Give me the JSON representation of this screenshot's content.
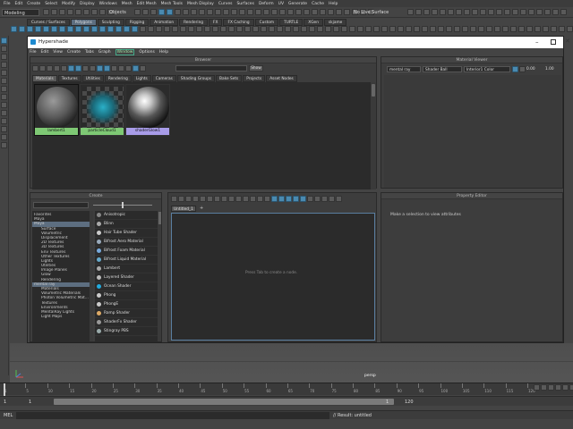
{
  "maya": {
    "menubar": [
      "File",
      "Edit",
      "Create",
      "Select",
      "Modify",
      "Display",
      "Windows",
      "Mesh",
      "Edit Mesh",
      "Mesh Tools",
      "Mesh Display",
      "Curves",
      "Surfaces",
      "Deform",
      "UV",
      "Generate",
      "Cache",
      "Help"
    ],
    "menuset": "Modeling",
    "objects_label": "Objects",
    "live_surface": "No Live Surface",
    "shelf_tabs": [
      "Curves / Surfaces",
      "Polygons",
      "Sculpting",
      "Rigging",
      "Animation",
      "Rendering",
      "FX",
      "FX Caching",
      "Custom",
      "TURTLE",
      "XGen",
      "skjame"
    ],
    "active_shelf": "Polygons",
    "viewport_label": "persp",
    "timeline_ticks": [
      "1",
      "5",
      "10",
      "15",
      "20",
      "25",
      "30",
      "35",
      "40",
      "45",
      "50",
      "55",
      "60",
      "65",
      "70",
      "75",
      "80",
      "85",
      "90",
      "95",
      "100",
      "105",
      "110",
      "115",
      "120"
    ],
    "range_start": "1",
    "range_start2": "1",
    "range_end_field": "1",
    "range_end": "120",
    "cmd_label": "MEL",
    "result_text": "// Result: untitled"
  },
  "hypershade": {
    "title": "Hypershade",
    "menubar": [
      "File",
      "Edit",
      "View",
      "Create",
      "Tabs",
      "Graph",
      "Window",
      "Options",
      "Help"
    ],
    "browser": {
      "title": "Browser",
      "show_label": "Show",
      "tabs": [
        "Materials",
        "Textures",
        "Utilities",
        "Rendering",
        "Lights",
        "Cameras",
        "Shading Groups",
        "Bake Sets",
        "Projects",
        "Asset Nodes"
      ],
      "active_tab": "Materials",
      "swatches": [
        {
          "label": "lambert1",
          "label_color": "#7ec874"
        },
        {
          "label": "particleCloud1",
          "label_color": "#7ec874"
        },
        {
          "label": "shaderGlow1",
          "label_color": "#a89ce8"
        }
      ]
    },
    "material_viewer": {
      "title": "Material Viewer",
      "renderer": "mental ray",
      "shape": "Shader Ball",
      "environment": "Interior1 Color",
      "value1": "0.00",
      "value2": "1.00"
    },
    "create": {
      "title": "Create",
      "categories": [
        "Favorites",
        "Maya",
        "Maya",
        "Surface",
        "Volumetric",
        "Displacement",
        "2D Textures",
        "3D Textures",
        "Env Textures",
        "Other Textures",
        "Lights",
        "Utilities",
        "Image Planes",
        "Glow",
        "Rendering",
        "mental ray",
        "Materials",
        "Volumetric Materials",
        "Photon Volumetric Mat...",
        "Textures",
        "Environments",
        "MentalRay Lights",
        "Light Maps"
      ],
      "shaders": [
        "Anisotropic",
        "Blinn",
        "Hair Tube Shader",
        "Bifrost Aero Material",
        "Bifrost Foam Material",
        "Bifrost Liquid Material",
        "Lambert",
        "Layered Shader",
        "Ocean Shader",
        "Phong",
        "PhongE",
        "Ramp Shader",
        "ShaderFx Shader",
        "Stingray PBS"
      ]
    },
    "work_area": {
      "tab_label": "Untitled_1",
      "hint": "Press Tab to create a node."
    },
    "property_editor": {
      "title": "Property Editor",
      "message": "Make a selection to view attributes"
    }
  }
}
